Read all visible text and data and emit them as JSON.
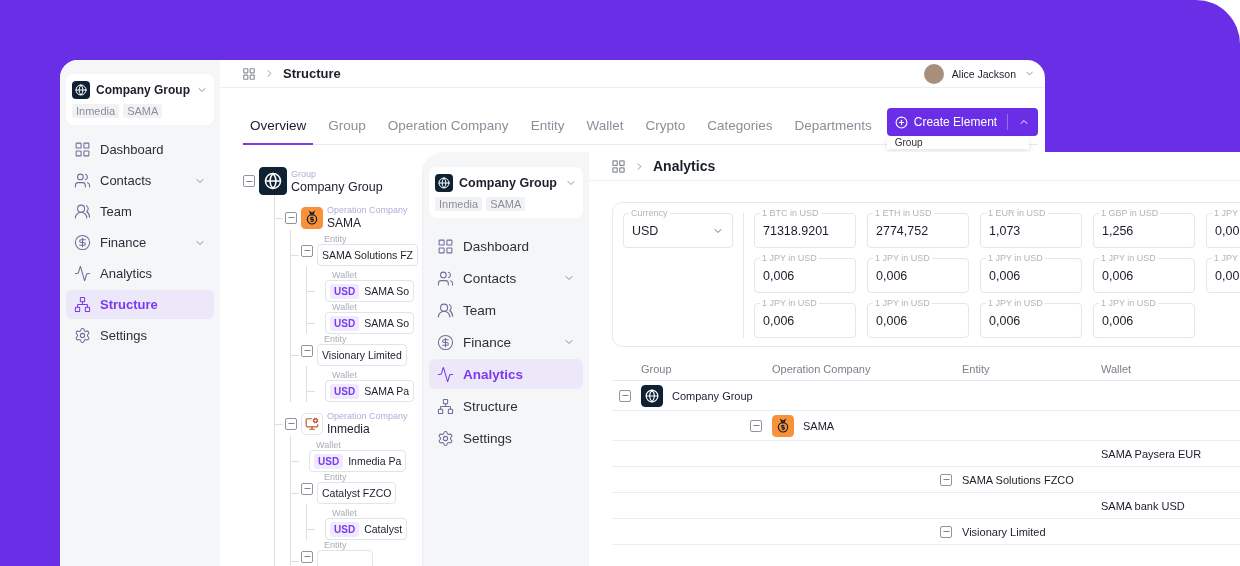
{
  "back_window": {
    "sidebar": {
      "company": {
        "name": "Company Group",
        "tags": [
          "Inmedia",
          "SAMA"
        ]
      },
      "items": [
        {
          "label": "Dashboard",
          "expandable": false,
          "selected": false
        },
        {
          "label": "Contacts",
          "expandable": true,
          "selected": false
        },
        {
          "label": "Team",
          "expandable": false,
          "selected": false
        },
        {
          "label": "Finance",
          "expandable": true,
          "selected": false
        },
        {
          "label": "Analytics",
          "expandable": false,
          "selected": false
        },
        {
          "label": "Structure",
          "expandable": false,
          "selected": true
        },
        {
          "label": "Settings",
          "expandable": false,
          "selected": false
        }
      ]
    },
    "breadcrumb": "Structure",
    "user": {
      "name": "Alice Jackson"
    },
    "tabs": [
      {
        "label": "Overview",
        "selected": true
      },
      {
        "label": "Group",
        "selected": false
      },
      {
        "label": "Operation Company",
        "selected": false
      },
      {
        "label": "Entity",
        "selected": false
      },
      {
        "label": "Wallet",
        "selected": false
      },
      {
        "label": "Crypto",
        "selected": false
      },
      {
        "label": "Categories",
        "selected": false
      },
      {
        "label": "Departments",
        "selected": false
      }
    ],
    "create_button": {
      "label": "Create Element",
      "menu_open": true,
      "menu_items": [
        "Group"
      ]
    },
    "tree": [
      {
        "kind": "group",
        "type_label": "Group",
        "name": "Company Group",
        "expanded": true,
        "children": [
          {
            "kind": "operation_company",
            "type_label": "Operation Company",
            "name": "SAMA",
            "expanded": true,
            "children": [
              {
                "kind": "entity",
                "type_label": "Entity",
                "name": "SAMA Solutions FZ",
                "expanded": true,
                "children": [
                  {
                    "kind": "wallet",
                    "type_label": "Wallet",
                    "currency": "USD",
                    "name": "SAMA So"
                  },
                  {
                    "kind": "wallet",
                    "type_label": "Wallet",
                    "currency": "USD",
                    "name": "SAMA So"
                  }
                ]
              },
              {
                "kind": "entity",
                "type_label": "Entity",
                "name": "Visionary Limited",
                "expanded": true,
                "children": [
                  {
                    "kind": "wallet",
                    "type_label": "Wallet",
                    "currency": "USD",
                    "name": "SAMA Pa"
                  }
                ]
              }
            ]
          },
          {
            "kind": "operation_company",
            "type_label": "Operation Company",
            "name": "Inmedia",
            "expanded": true,
            "children": [
              {
                "kind": "wallet",
                "type_label": "Wallet",
                "currency": "USD",
                "name": "Inmedia Pa"
              },
              {
                "kind": "entity",
                "type_label": "Entity",
                "name": "Catalyst FZCO",
                "expanded": true,
                "children": [
                  {
                    "kind": "wallet",
                    "type_label": "Wallet",
                    "currency": "USD",
                    "name": "Catalyst"
                  }
                ]
              },
              {
                "kind": "entity",
                "type_label": "Entity",
                "expanded": true
              }
            ]
          }
        ]
      }
    ]
  },
  "front_window": {
    "sidebar": {
      "company": {
        "name": "Company Group",
        "tags": [
          "Inmedia",
          "SAMA"
        ]
      },
      "items": [
        {
          "label": "Dashboard",
          "expandable": false,
          "selected": false
        },
        {
          "label": "Contacts",
          "expandable": true,
          "selected": false
        },
        {
          "label": "Team",
          "expandable": false,
          "selected": false
        },
        {
          "label": "Finance",
          "expandable": true,
          "selected": false
        },
        {
          "label": "Analytics",
          "expandable": false,
          "selected": true
        },
        {
          "label": "Structure",
          "expandable": false,
          "selected": false
        },
        {
          "label": "Settings",
          "expandable": false,
          "selected": false
        }
      ]
    },
    "breadcrumb": "Analytics",
    "currency": {
      "label": "Currency",
      "value": "USD"
    },
    "rates": [
      [
        {
          "label": "1 BTC in USD",
          "value": "71318.9201"
        },
        {
          "label": "1 ETH in USD",
          "value": "2774,752"
        },
        {
          "label": "1 EUR in USD",
          "value": "1,073"
        },
        {
          "label": "1 GBP in USD",
          "value": "1,256"
        },
        {
          "label": "1 JPY",
          "value": "0,00"
        }
      ],
      [
        {
          "label": "1 JPY in USD",
          "value": "0,006"
        },
        {
          "label": "1 JPY in USD",
          "value": "0,006"
        },
        {
          "label": "1 JPY in USD",
          "value": "0,006"
        },
        {
          "label": "1 JPY in USD",
          "value": "0,006"
        },
        {
          "label": "1 JPY",
          "value": "0,00"
        }
      ],
      [
        {
          "label": "1 JPY in USD",
          "value": "0,006"
        },
        {
          "label": "1 JPY in USD",
          "value": "0,006"
        },
        {
          "label": "1 JPY in USD",
          "value": "0,006"
        },
        {
          "label": "1 JPY in USD",
          "value": "0,006"
        }
      ]
    ],
    "table": {
      "columns": [
        "Group",
        "Operation Company",
        "Entity",
        "Wallet"
      ],
      "rows": [
        {
          "kind": "group",
          "label": "Company Group",
          "expanded": true
        },
        {
          "kind": "operation_company",
          "label": "SAMA",
          "expanded": true
        },
        {
          "kind": "wallet",
          "label": "SAMA Paysera EUR"
        },
        {
          "kind": "entity",
          "label": "SAMA Solutions FZCO",
          "expanded": true
        },
        {
          "kind": "wallet",
          "label": "SAMA bank USD"
        },
        {
          "kind": "entity",
          "label": "Visionary Limited",
          "expanded": true
        }
      ]
    }
  }
}
